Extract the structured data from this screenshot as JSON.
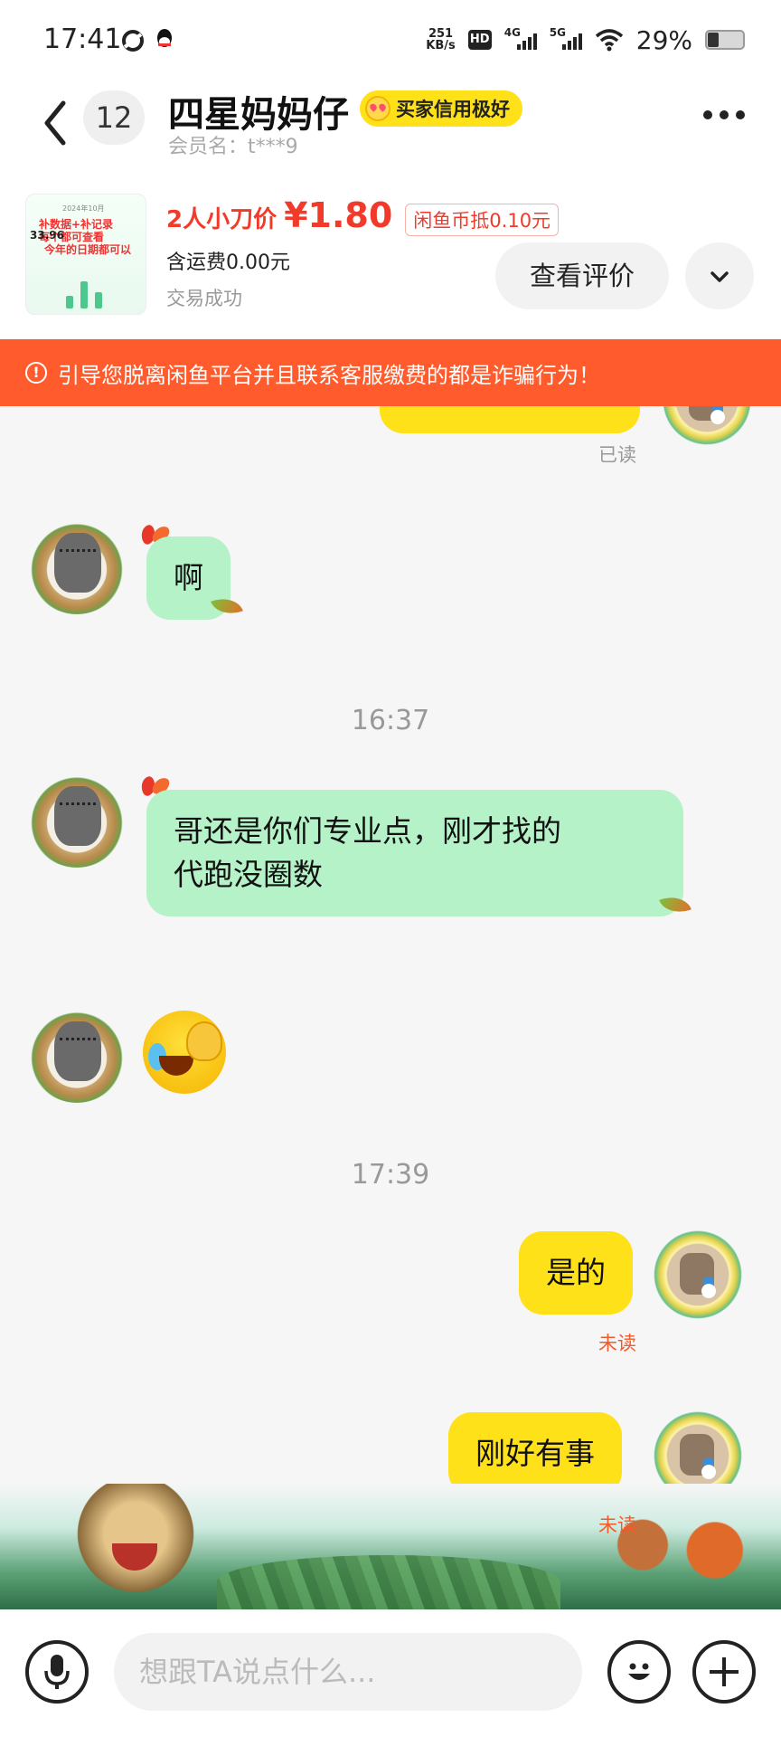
{
  "status_bar": {
    "time": "17:41",
    "net_speed": "251",
    "net_speed_unit": "KB/s",
    "hd": "HD",
    "net1": "4G",
    "net2": "5G",
    "battery": "29%"
  },
  "header": {
    "unread_count": "12",
    "title": "四星妈妈仔",
    "badge": "买家信用极好",
    "member": "会员名：t***9"
  },
  "product": {
    "thumb_title": "2024年10月",
    "thumb_line1": "补数据+补记录",
    "thumb_line2": "每个都可查看",
    "thumb_line3": "今年的日期都可以",
    "thumb_value": "33.96",
    "price_tag": "2人小刀价",
    "price": "¥1.80",
    "coin": "闲鱼币抵0.10元",
    "shipping": "含运费0.00元",
    "status": "交易成功",
    "review_button": "查看评价"
  },
  "warning": {
    "icon": "!",
    "text": "引导您脱离闲鱼平台并且联系客服缴费的都是诈骗行为！"
  },
  "chat": {
    "read_label": "已读",
    "msg1": "啊",
    "time1": "16:37",
    "msg2_line1": "哥还是你们专业点，刚才找的",
    "msg2_line2": "代跑没圈数",
    "time2": "17:39",
    "msg3": "是的",
    "unread1": "未读",
    "msg4": "刚好有事",
    "unread2": "未读"
  },
  "input": {
    "placeholder": "想跟TA说点什么..."
  },
  "colors": {
    "brand_yellow": "#ffe11a",
    "incoming_bubble": "#b5f2c8",
    "warning_bar": "#ff5b2c",
    "price_red": "#f23a2a"
  },
  "icons": [
    "back-icon",
    "more-icon",
    "chevron-down-icon",
    "warning-icon",
    "mic-icon",
    "emoji-icon",
    "plus-icon"
  ]
}
